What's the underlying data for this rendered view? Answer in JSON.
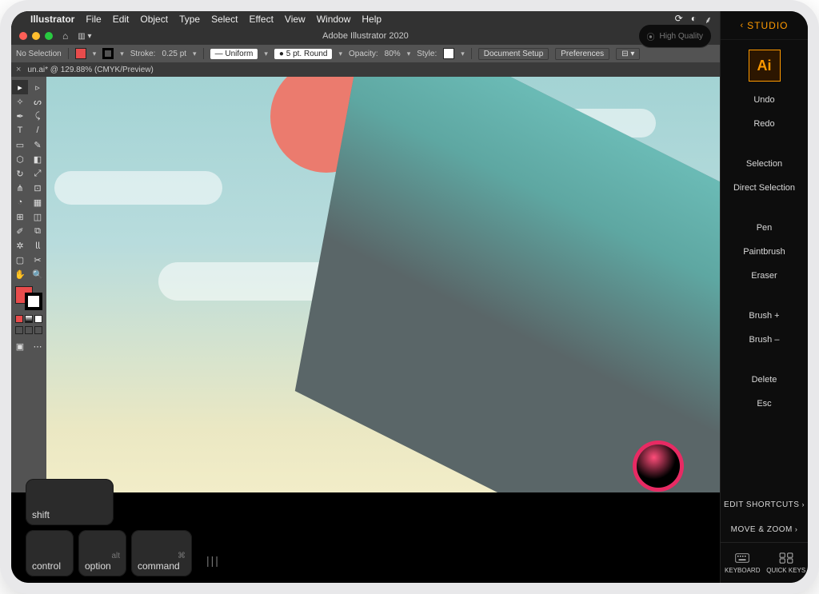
{
  "menubar": {
    "app": "Illustrator",
    "items": [
      "File",
      "Edit",
      "Object",
      "Type",
      "Select",
      "Effect",
      "View",
      "Window",
      "Help"
    ]
  },
  "window": {
    "title": "Adobe Illustrator 2020",
    "doc_tab": "un.ai* @ 129.88% (CMYK/Preview)"
  },
  "control": {
    "selection": "No Selection",
    "stroke_label": "Stroke:",
    "stroke_weight": "0.25 pt",
    "profile": "Uniform",
    "brush": "5 pt. Round",
    "opacity_label": "Opacity:",
    "opacity": "80%",
    "style_label": "Style:",
    "doc_setup": "Document Setup",
    "prefs": "Preferences"
  },
  "modkeys": {
    "shift": "shift",
    "control": "control",
    "option": "option",
    "option_sym": "alt",
    "command": "command",
    "command_sym": "⌘"
  },
  "status_chip": "High Quality",
  "studio": {
    "title": "STUDIO",
    "undo": "Undo",
    "redo": "Redo",
    "selection": "Selection",
    "direct": "Direct Selection",
    "pen": "Pen",
    "paintbrush": "Paintbrush",
    "eraser": "Eraser",
    "brush_inc": "Brush +",
    "brush_dec": "Brush –",
    "delete": "Delete",
    "esc": "Esc",
    "edit_shortcuts": "EDIT SHORTCUTS",
    "move_zoom": "MOVE & ZOOM",
    "keyboard": "KEYBOARD",
    "quick_keys": "QUICK KEYS"
  }
}
